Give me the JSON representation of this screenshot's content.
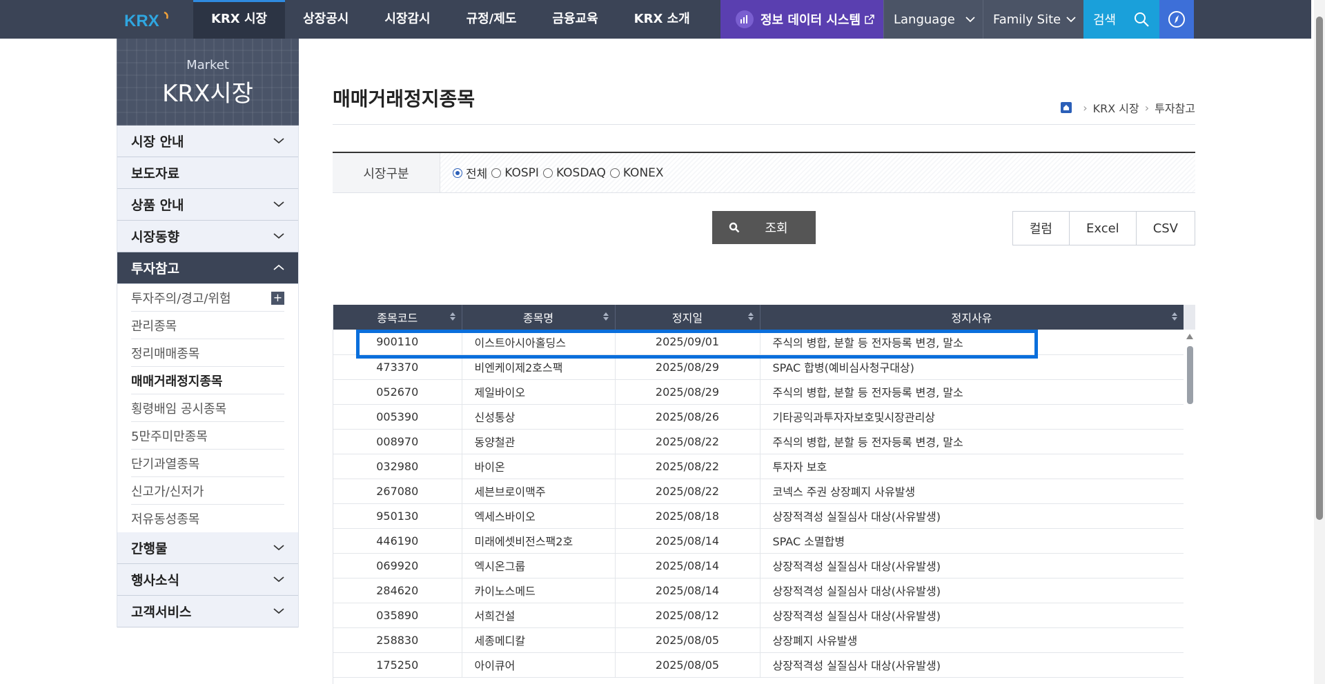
{
  "topnav": {
    "logo": "KRX",
    "items": [
      "KRX 시장",
      "상장공시",
      "시장감시",
      "규정/제도",
      "금융교육",
      "KRX 소개"
    ],
    "data_system": "정보 데이터 시스템",
    "language": "Language",
    "family_site": "Family Site",
    "search": "검색"
  },
  "sidebar": {
    "hero_sub": "Market",
    "hero_main": "KRX시장",
    "items_top": [
      "시장 안내",
      "보도자료",
      "상품 안내",
      "시장동향"
    ],
    "open_item": "투자참고",
    "sub_items": [
      "투자주의/경고/위험",
      "관리종목",
      "정리매매종목",
      "매매거래정지종목",
      "횡령배임 공시종목",
      "5만주미만종목",
      "단기과열종목",
      "신고가/신저가",
      "저유동성종목"
    ],
    "current_sub": "매매거래정지종목",
    "items_bottom": [
      "간행물",
      "행사소식",
      "고객서비스"
    ]
  },
  "page": {
    "title": "매매거래정지종목",
    "breadcrumb": [
      "KRX 시장",
      "투자참고"
    ]
  },
  "filter": {
    "label": "시장구분",
    "options": [
      "전체",
      "KOSPI",
      "KOSDAQ",
      "KONEX"
    ],
    "selected": "전체"
  },
  "buttons": {
    "search": "조회",
    "column": "컬럼",
    "excel": "Excel",
    "csv": "CSV"
  },
  "table": {
    "headers": [
      "종목코드",
      "종목명",
      "정지일",
      "정지사유"
    ],
    "rows": [
      [
        "900110",
        "이스트아시아홀딩스",
        "2025/09/01",
        "주식의 병합, 분할 등 전자등록 변경, 말소"
      ],
      [
        "473370",
        "비엔케이제2호스팩",
        "2025/08/29",
        "SPAC 합병(예비심사청구대상)"
      ],
      [
        "052670",
        "제일바이오",
        "2025/08/29",
        "주식의 병합, 분할 등 전자등록 변경, 말소"
      ],
      [
        "005390",
        "신성통상",
        "2025/08/26",
        "기타공익과투자자보호및시장관리상"
      ],
      [
        "008970",
        "동양철관",
        "2025/08/22",
        "주식의 병합, 분할 등 전자등록 변경, 말소"
      ],
      [
        "032980",
        "바이온",
        "2025/08/22",
        "투자자 보호"
      ],
      [
        "267080",
        "세븐브로이맥주",
        "2025/08/22",
        "코넥스 주권 상장폐지 사유발생"
      ],
      [
        "950130",
        "엑세스바이오",
        "2025/08/18",
        "상장적격성 실질심사 대상(사유발생)"
      ],
      [
        "446190",
        "미래에셋비전스팩2호",
        "2025/08/14",
        "SPAC 소멸합병"
      ],
      [
        "069920",
        "엑시온그룹",
        "2025/08/14",
        "상장적격성 실질심사 대상(사유발생)"
      ],
      [
        "284620",
        "카이노스메드",
        "2025/08/14",
        "상장적격성 실질심사 대상(사유발생)"
      ],
      [
        "035890",
        "서희건설",
        "2025/08/12",
        "상장적격성 실질심사 대상(사유발생)"
      ],
      [
        "258830",
        "세종메디칼",
        "2025/08/05",
        "상장폐지 사유발생"
      ],
      [
        "175250",
        "아이큐어",
        "2025/08/05",
        "상장적격성 실질심사 대상(사유발생)"
      ]
    ]
  },
  "colors": {
    "topbar": "#3b4456",
    "data_system": "#5a3fb0",
    "search": "#1aa0da",
    "highlight": "#0a6fdc"
  }
}
